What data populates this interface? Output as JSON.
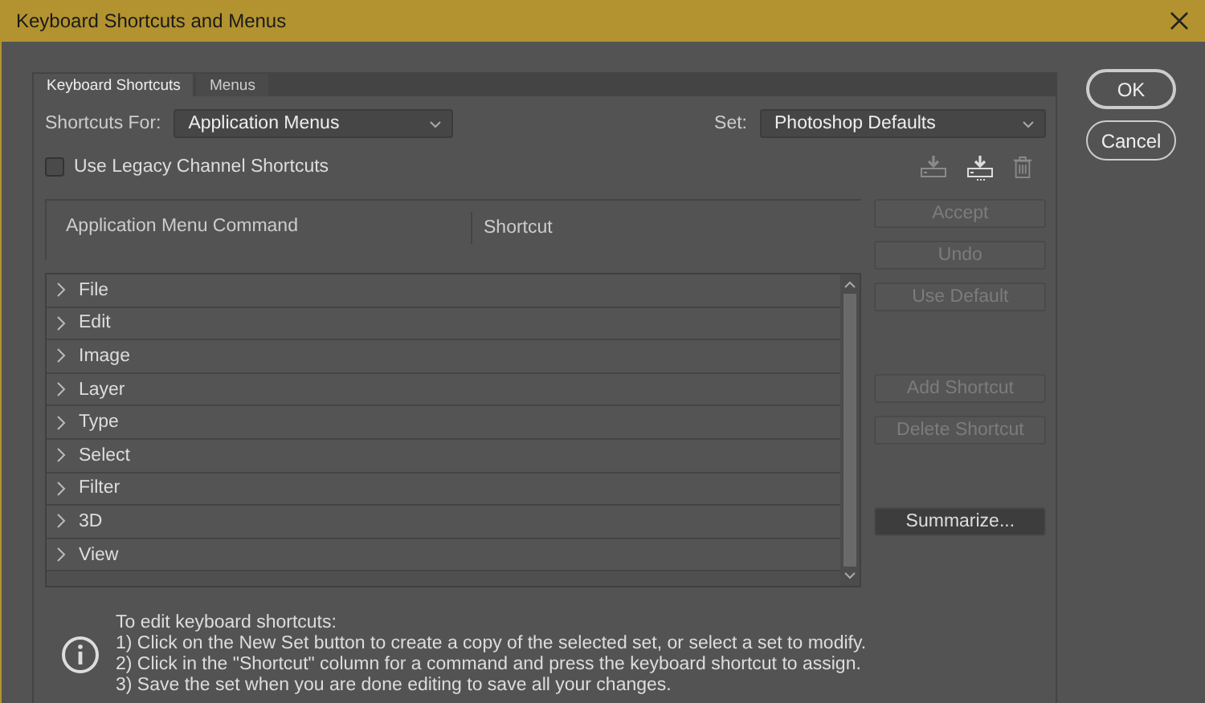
{
  "window": {
    "title": "Keyboard Shortcuts and Menus"
  },
  "tabs": [
    {
      "label": "Keyboard Shortcuts",
      "selected": true
    },
    {
      "label": "Menus",
      "selected": false
    }
  ],
  "shortcuts_for": {
    "label": "Shortcuts For:",
    "value": "Application Menus"
  },
  "set": {
    "label": "Set:",
    "value": "Photoshop Defaults"
  },
  "legacy_checkbox": {
    "label": "Use Legacy Channel Shortcuts",
    "checked": false
  },
  "table": {
    "columns": [
      "Application Menu Command",
      "Shortcut"
    ],
    "rows": [
      {
        "label": "File",
        "expanded": false
      },
      {
        "label": "Edit",
        "expanded": false
      },
      {
        "label": "Image",
        "expanded": false
      },
      {
        "label": "Layer",
        "expanded": false
      },
      {
        "label": "Type",
        "expanded": false
      },
      {
        "label": "Select",
        "expanded": false
      },
      {
        "label": "Filter",
        "expanded": false
      },
      {
        "label": "3D",
        "expanded": false
      },
      {
        "label": "View",
        "expanded": false
      }
    ]
  },
  "side_button_groups": [
    [
      {
        "label": "Accept",
        "disabled": true
      },
      {
        "label": "Undo",
        "disabled": true
      },
      {
        "label": "Use Default",
        "disabled": true
      }
    ],
    [
      {
        "label": "Add Shortcut",
        "disabled": true
      },
      {
        "label": "Delete Shortcut",
        "disabled": true
      }
    ],
    [
      {
        "label": "Summarize...",
        "disabled": false
      }
    ]
  ],
  "info": [
    "To edit keyboard shortcuts:",
    "1) Click on the New Set button to create a copy of the selected set, or select a set to modify.",
    "2) Click in the \"Shortcut\" column for a command and press the keyboard shortcut to assign.",
    "3) Save the set when you are done editing to save all your changes."
  ],
  "dialog_buttons": [
    {
      "label": "OK",
      "kind": "primary"
    },
    {
      "label": "Cancel",
      "kind": "secondary"
    }
  ]
}
